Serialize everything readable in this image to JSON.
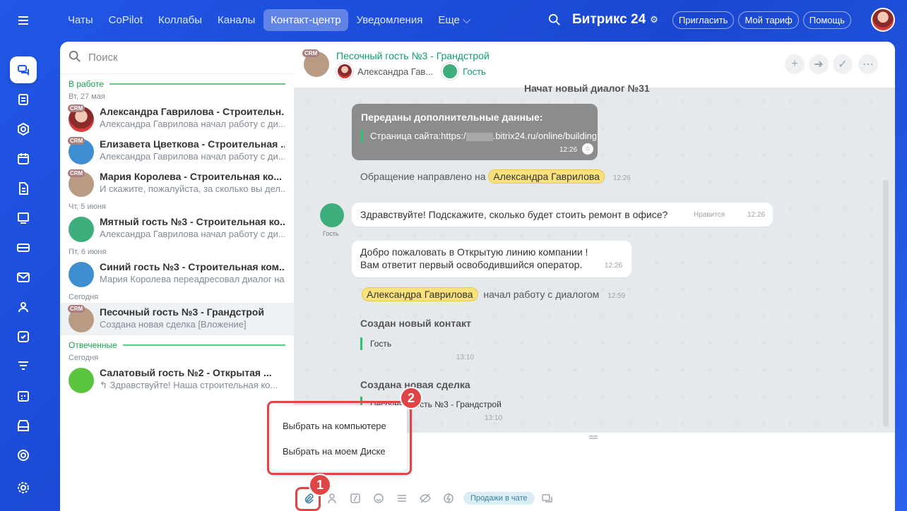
{
  "nav": {
    "tabs": [
      "Чаты",
      "CoPilot",
      "Коллабы",
      "Каналы",
      "Контакт-центр",
      "Уведомления",
      "Еще ⌵"
    ],
    "brand": "Битрикс 24",
    "invite": "Пригласить",
    "tariff": "Мой тариф",
    "help": "Помощь"
  },
  "sidebar_icons": [
    "menu-icon",
    "chat-icon",
    "tasks-icon",
    "hexagon-icon",
    "calendar-icon",
    "document-icon",
    "crm-icon",
    "card-icon",
    "mail-icon",
    "users-icon",
    "checkbox-icon",
    "funnel-icon",
    "schedule-icon",
    "shop-icon",
    "target-icon",
    "settings-icon"
  ],
  "left": {
    "search_placeholder": "Поиск",
    "section_work": "В работе",
    "section_answered": "Отвеченные",
    "crm_badge": "CRM",
    "items": [
      {
        "date": "Вт, 27 мая",
        "title": "Александра Гаврилова - Строительн...",
        "sub": "Александра Гаврилова начал работу с ди..."
      },
      {
        "date": "",
        "title": "Елизавета Цветкова - Строительная ...",
        "sub": "Александра Гаврилова начал работу с ди..."
      },
      {
        "date": "",
        "title": "Мария Королева - Строительная ко...",
        "sub": "И скажите, пожалуйста, за сколько вы дел..."
      },
      {
        "date": "Чт, 5 июня",
        "title": "Мятный гость №3 - Строительная ко...",
        "sub": "Александра Гаврилова начал работу с ди..."
      },
      {
        "date": "Пт, 6 июня",
        "title": "Синий гость №3 - Строительная ком...",
        "sub": "Мария Королева переадресовал диалог на..."
      },
      {
        "date": "Сегодня",
        "title": "Песочный гость №3 - Грандстрой",
        "sub": "Создана новая сделка [Вложение]"
      },
      {
        "date": "Сегодня",
        "title": "Салатовый гость №2 - Открытая ...",
        "sub": "↰ Здравствуйте! Наша строительная ко..."
      }
    ]
  },
  "chat": {
    "title": "Песочный гость №3 - Грандстрой",
    "operator": "Александра Гав...",
    "guest_label": "Гость",
    "new_dialog": "Начат новый диалог №31",
    "card_title": "Переданы дополнительные данные:",
    "card_text": "Страница сайта:https:/",
    "card_url": ".bitrix24.ru/online/building",
    "card_time": "12:26",
    "routed_text": "Обращение направлено на",
    "operator_full": "Александра Гаврилова",
    "routed_time": "12:26",
    "guest_msg": "Здравствуйте! Подскажите, сколько будет стоить ремонт в офисе?",
    "like": "Нравится",
    "guest_time": "12:26",
    "welcome1": "Добро пожаловать в Открытую линию компании !",
    "welcome2": "Вам ответит первый освободившийся оператор.",
    "welcome_time": "12:26",
    "started_text": "начал работу с диалогом",
    "started_time": "12:59",
    "contact_title": "Создан новый контакт",
    "contact_value": "Гость",
    "contact_time": "13:10",
    "deal_title": "Создана новая сделка",
    "deal_value": "Песочный гость №3 - Грандстрой",
    "deal_time": "13:10"
  },
  "popup": {
    "from_computer": "Выбрать на компьютере",
    "from_disk": "Выбрать на моем Диске"
  },
  "toolbar": {
    "sales": "Продажи в чате"
  },
  "badges": {
    "one": "1",
    "two": "2"
  }
}
